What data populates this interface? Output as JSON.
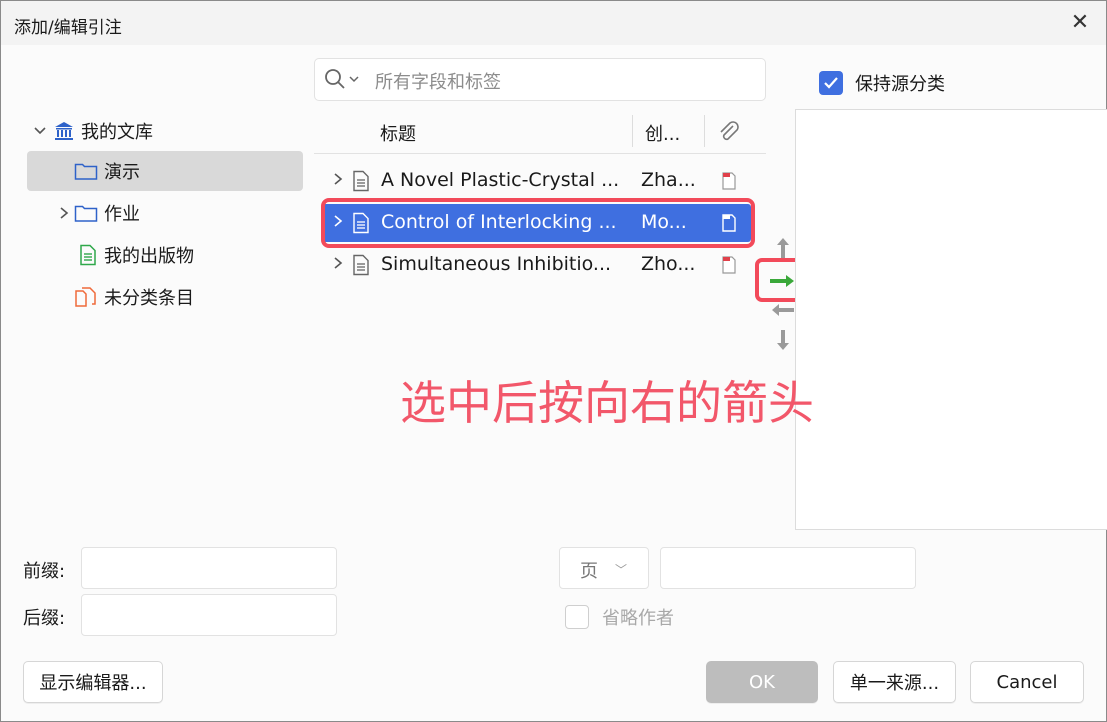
{
  "window": {
    "title": "添加/编辑引注",
    "close_label": "✕",
    "top_strip_text": "..."
  },
  "search": {
    "placeholder": "所有字段和标签"
  },
  "library": {
    "root": "我的文库",
    "items": [
      {
        "label": "演示",
        "selected": true
      },
      {
        "label": "作业",
        "expandable": true
      },
      {
        "label": "我的出版物"
      },
      {
        "label": "未分类条目"
      }
    ]
  },
  "columns": {
    "title": "标题",
    "creator": "创..."
  },
  "rows": [
    {
      "title": "A Novel Plastic-Crystal ...",
      "creator": "Zha..."
    },
    {
      "title": "Control of Interlocking ...",
      "creator": "Mo...",
      "selected": true
    },
    {
      "title": "Simultaneous Inhibitio...",
      "creator": "Zho..."
    }
  ],
  "keep_sorted": {
    "label": "保持源分类",
    "checked": true
  },
  "annotation": {
    "text": "选中后按向右的箭头",
    "color": "#f2576a"
  },
  "form": {
    "prefix_label": "前缀:",
    "suffix_label": "后缀:",
    "locator_type": "页",
    "omit_author_label": "省略作者"
  },
  "buttons": {
    "show_editor": "显示编辑器...",
    "ok": "OK",
    "single_source": "单一来源...",
    "cancel": "Cancel"
  },
  "colors": {
    "accent": "#3f6fe0",
    "highlight_box": "#f24a5a",
    "arrow_green": "#3aa83a"
  }
}
